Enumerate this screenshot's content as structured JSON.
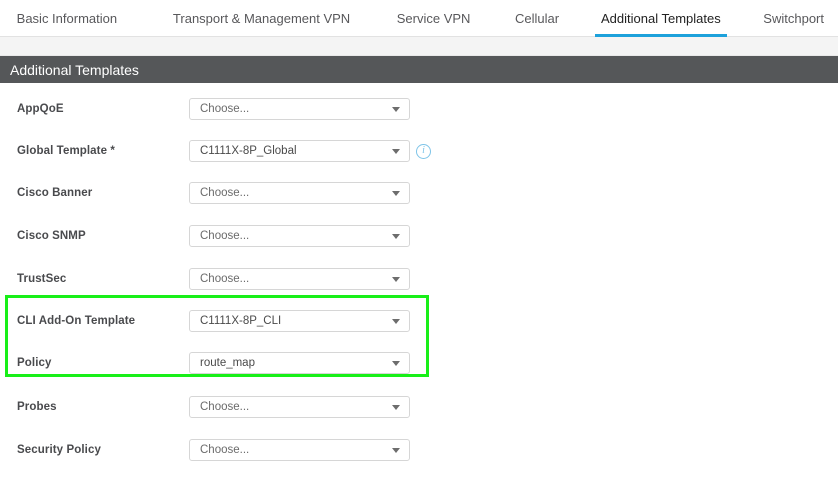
{
  "tabs": [
    {
      "label": "Basic Information",
      "active": false
    },
    {
      "label": "Transport & Management VPN",
      "active": false
    },
    {
      "label": "Service VPN",
      "active": false
    },
    {
      "label": "Cellular",
      "active": false
    },
    {
      "label": "Additional Templates",
      "active": true
    },
    {
      "label": "Switchport",
      "active": false
    }
  ],
  "section": {
    "title": "Additional Templates"
  },
  "colors": {
    "active_tab_underline": "#1da1db",
    "banner_background": "#555759",
    "highlight_border": "#18ef18",
    "info_icon": "#7ec4e8"
  },
  "form": {
    "rows": [
      {
        "label": "AppQoE",
        "required": false,
        "value": "Choose...",
        "is_placeholder": true,
        "has_info_icon": false
      },
      {
        "label": "Global Template *",
        "required": true,
        "value": "C1111X-8P_Global",
        "is_placeholder": false,
        "has_info_icon": true
      },
      {
        "label": "Cisco Banner",
        "required": false,
        "value": "Choose...",
        "is_placeholder": true,
        "has_info_icon": false
      },
      {
        "label": "Cisco SNMP",
        "required": false,
        "value": "Choose...",
        "is_placeholder": true,
        "has_info_icon": false
      },
      {
        "label": "TrustSec",
        "required": false,
        "value": "Choose...",
        "is_placeholder": true,
        "has_info_icon": false
      },
      {
        "label": "CLI Add-On Template",
        "required": false,
        "value": "C1111X-8P_CLI",
        "is_placeholder": false,
        "has_info_icon": false
      },
      {
        "label": "Policy",
        "required": false,
        "value": "route_map",
        "is_placeholder": false,
        "has_info_icon": false
      },
      {
        "label": "Probes",
        "required": false,
        "value": "Choose...",
        "is_placeholder": true,
        "has_info_icon": false
      },
      {
        "label": "Security Policy",
        "required": false,
        "value": "Choose...",
        "is_placeholder": true,
        "has_info_icon": false
      }
    ]
  },
  "annotation": {
    "highlight_label": "cli-add-on-and-policy-highlight"
  }
}
